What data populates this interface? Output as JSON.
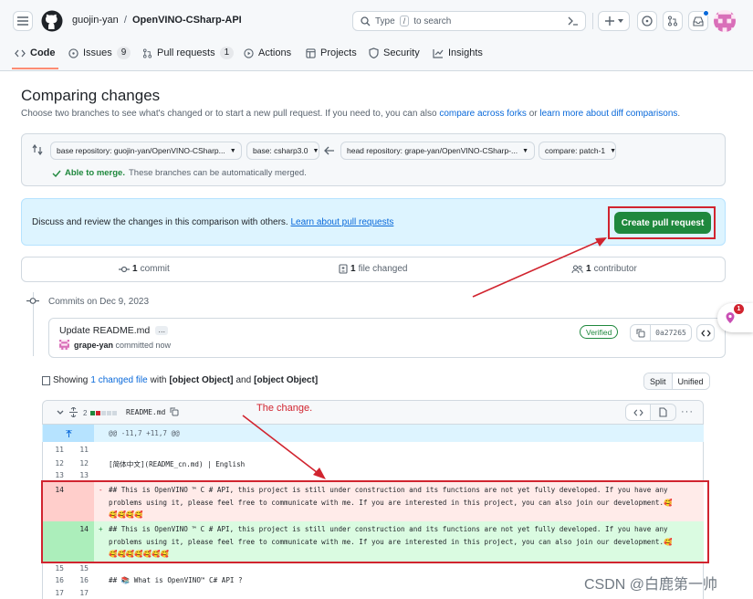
{
  "header": {
    "owner": "guojin-yan",
    "separator": "/",
    "repo": "OpenVINO-CSharp-API",
    "search": {
      "prefix": "Type",
      "key": "/",
      "suffix": "to search"
    }
  },
  "tabs": [
    {
      "label": "Code"
    },
    {
      "label": "Issues",
      "count": "9"
    },
    {
      "label": "Pull requests",
      "count": "1"
    },
    {
      "label": "Actions"
    },
    {
      "label": "Projects"
    },
    {
      "label": "Security"
    },
    {
      "label": "Insights"
    }
  ],
  "page": {
    "title": "Comparing changes",
    "subtitle": "Choose two branches to see what's changed or to start a new pull request. If you need to, you can also",
    "link1": "compare across forks",
    "or": "or",
    "link2": "learn more about diff comparisons",
    "end": "."
  },
  "compare": {
    "base_repo": "base repository: guojin-yan/OpenVINO-CSharp...",
    "base": "base: csharp3.0",
    "head_repo": "head repository: grape-yan/OpenVINO-CSharp-...",
    "compare": "compare: patch-1",
    "merge_strong": "Able to merge.",
    "merge_text": "These branches can be automatically merged."
  },
  "discuss": {
    "text": "Discuss and review the changes in this comparison with others.",
    "link": "Learn about pull requests",
    "button": "Create pull request"
  },
  "stats": {
    "commits_n": "1",
    "commits": "commit",
    "files_n": "1",
    "files": "file changed",
    "contrib_n": "1",
    "contrib": "contributor"
  },
  "commits": {
    "date": "Commits on Dec 9, 2023",
    "title": "Update README.md",
    "more": "…",
    "author": "grape-yan",
    "action": "committed now",
    "verified": "Verified",
    "sha": "0a27265"
  },
  "side_badge": "1",
  "diff": {
    "showing": "Showing",
    "changed_n": "1",
    "changed": "changed file",
    "with": "with",
    "add": {
      "n": "14",
      "sign": "+",
      "line1": "## This is OpenVINO ™  C # API, this project is still under construction and its functions are not yet fully developed. If you have any",
      "line2": "problems using it, please feel free to communicate with me. If you are interested in this project, you can also join our development.🥰",
      "line3": "🥰🥰🥰🥰🥰🥰🥰"
    },
    "and": "and",
    "del": {
      "o": "14",
      "sign": "-",
      "line1": "## This is OpenVINO ™  C # API, this project is still under construction and its functions are not yet fully developed. If you have any",
      "line2": "problems using it, please feel free to communicate with me. If you are interested in this project, you can also join our development.🥰",
      "line3": "🥰🥰🥰🥰"
    },
    "split": "Split",
    "unified": "Unified",
    "file_count": "2",
    "filename": "README.md",
    "hunk": "@@ -11,7 +11,7 @@",
    "annotation": "The change.",
    "rows": [
      {
        "o": "11",
        "n": "11",
        "t": ""
      },
      {
        "o": "12",
        "n": "12",
        "t": "[简体中文](README_cn.md) | English"
      },
      {
        "o": "13",
        "n": "13",
        "t": ""
      }
    ],
    "after": [
      {
        "o": "15",
        "n": "15",
        "t": ""
      },
      {
        "o": "16",
        "n": "16",
        "t": "## 📚 What is OpenVINO™ C# API ?"
      },
      {
        "o": "17",
        "n": "17",
        "t": ""
      }
    ]
  },
  "watermark": "CSDN @白鹿第一帅",
  "colors": {
    "accent": "#0969da",
    "green": "#1f883d",
    "red_annot": "#d1242f",
    "del_bg": "#ffebe9",
    "add_bg": "#dafbe1"
  }
}
